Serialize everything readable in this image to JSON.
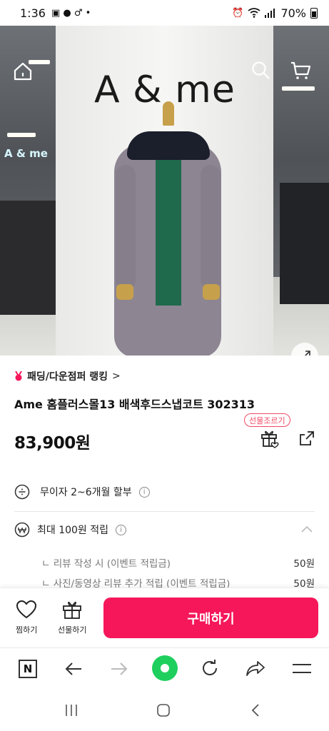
{
  "status": {
    "time": "1:36",
    "battery": "70%"
  },
  "hero": {
    "brand_sign": "A & me",
    "side_sign": "A & me"
  },
  "product": {
    "ranking_label": "패딩/다운점퍼 랭킹",
    "ranking_chevron": ">",
    "title": "Ame 홈플러스몰13 배색후드스냅코트 302313",
    "price": "83,900원",
    "gift_badge": "선물조르기"
  },
  "benefits": {
    "installment": "무이자 2~6개월 할부",
    "points": "최대 100원 적립",
    "sub_items": [
      {
        "label": "리뷰 작성 시 (이벤트 적립금)",
        "amount": "50원"
      },
      {
        "label": "사진/동영상 리뷰 추가 적립 (이벤트 적립금)",
        "amount": "50원"
      }
    ]
  },
  "actions": {
    "wish_label": "찜하기",
    "gift_label": "선물하기",
    "buy_label": "구매하기"
  },
  "colors": {
    "accent": "#f5175a",
    "browser_home": "#1ecf5e"
  },
  "icons": [
    "home-icon",
    "search-icon",
    "cart-icon",
    "expand-icon",
    "heart-icon",
    "gift-icon",
    "share-icon"
  ]
}
